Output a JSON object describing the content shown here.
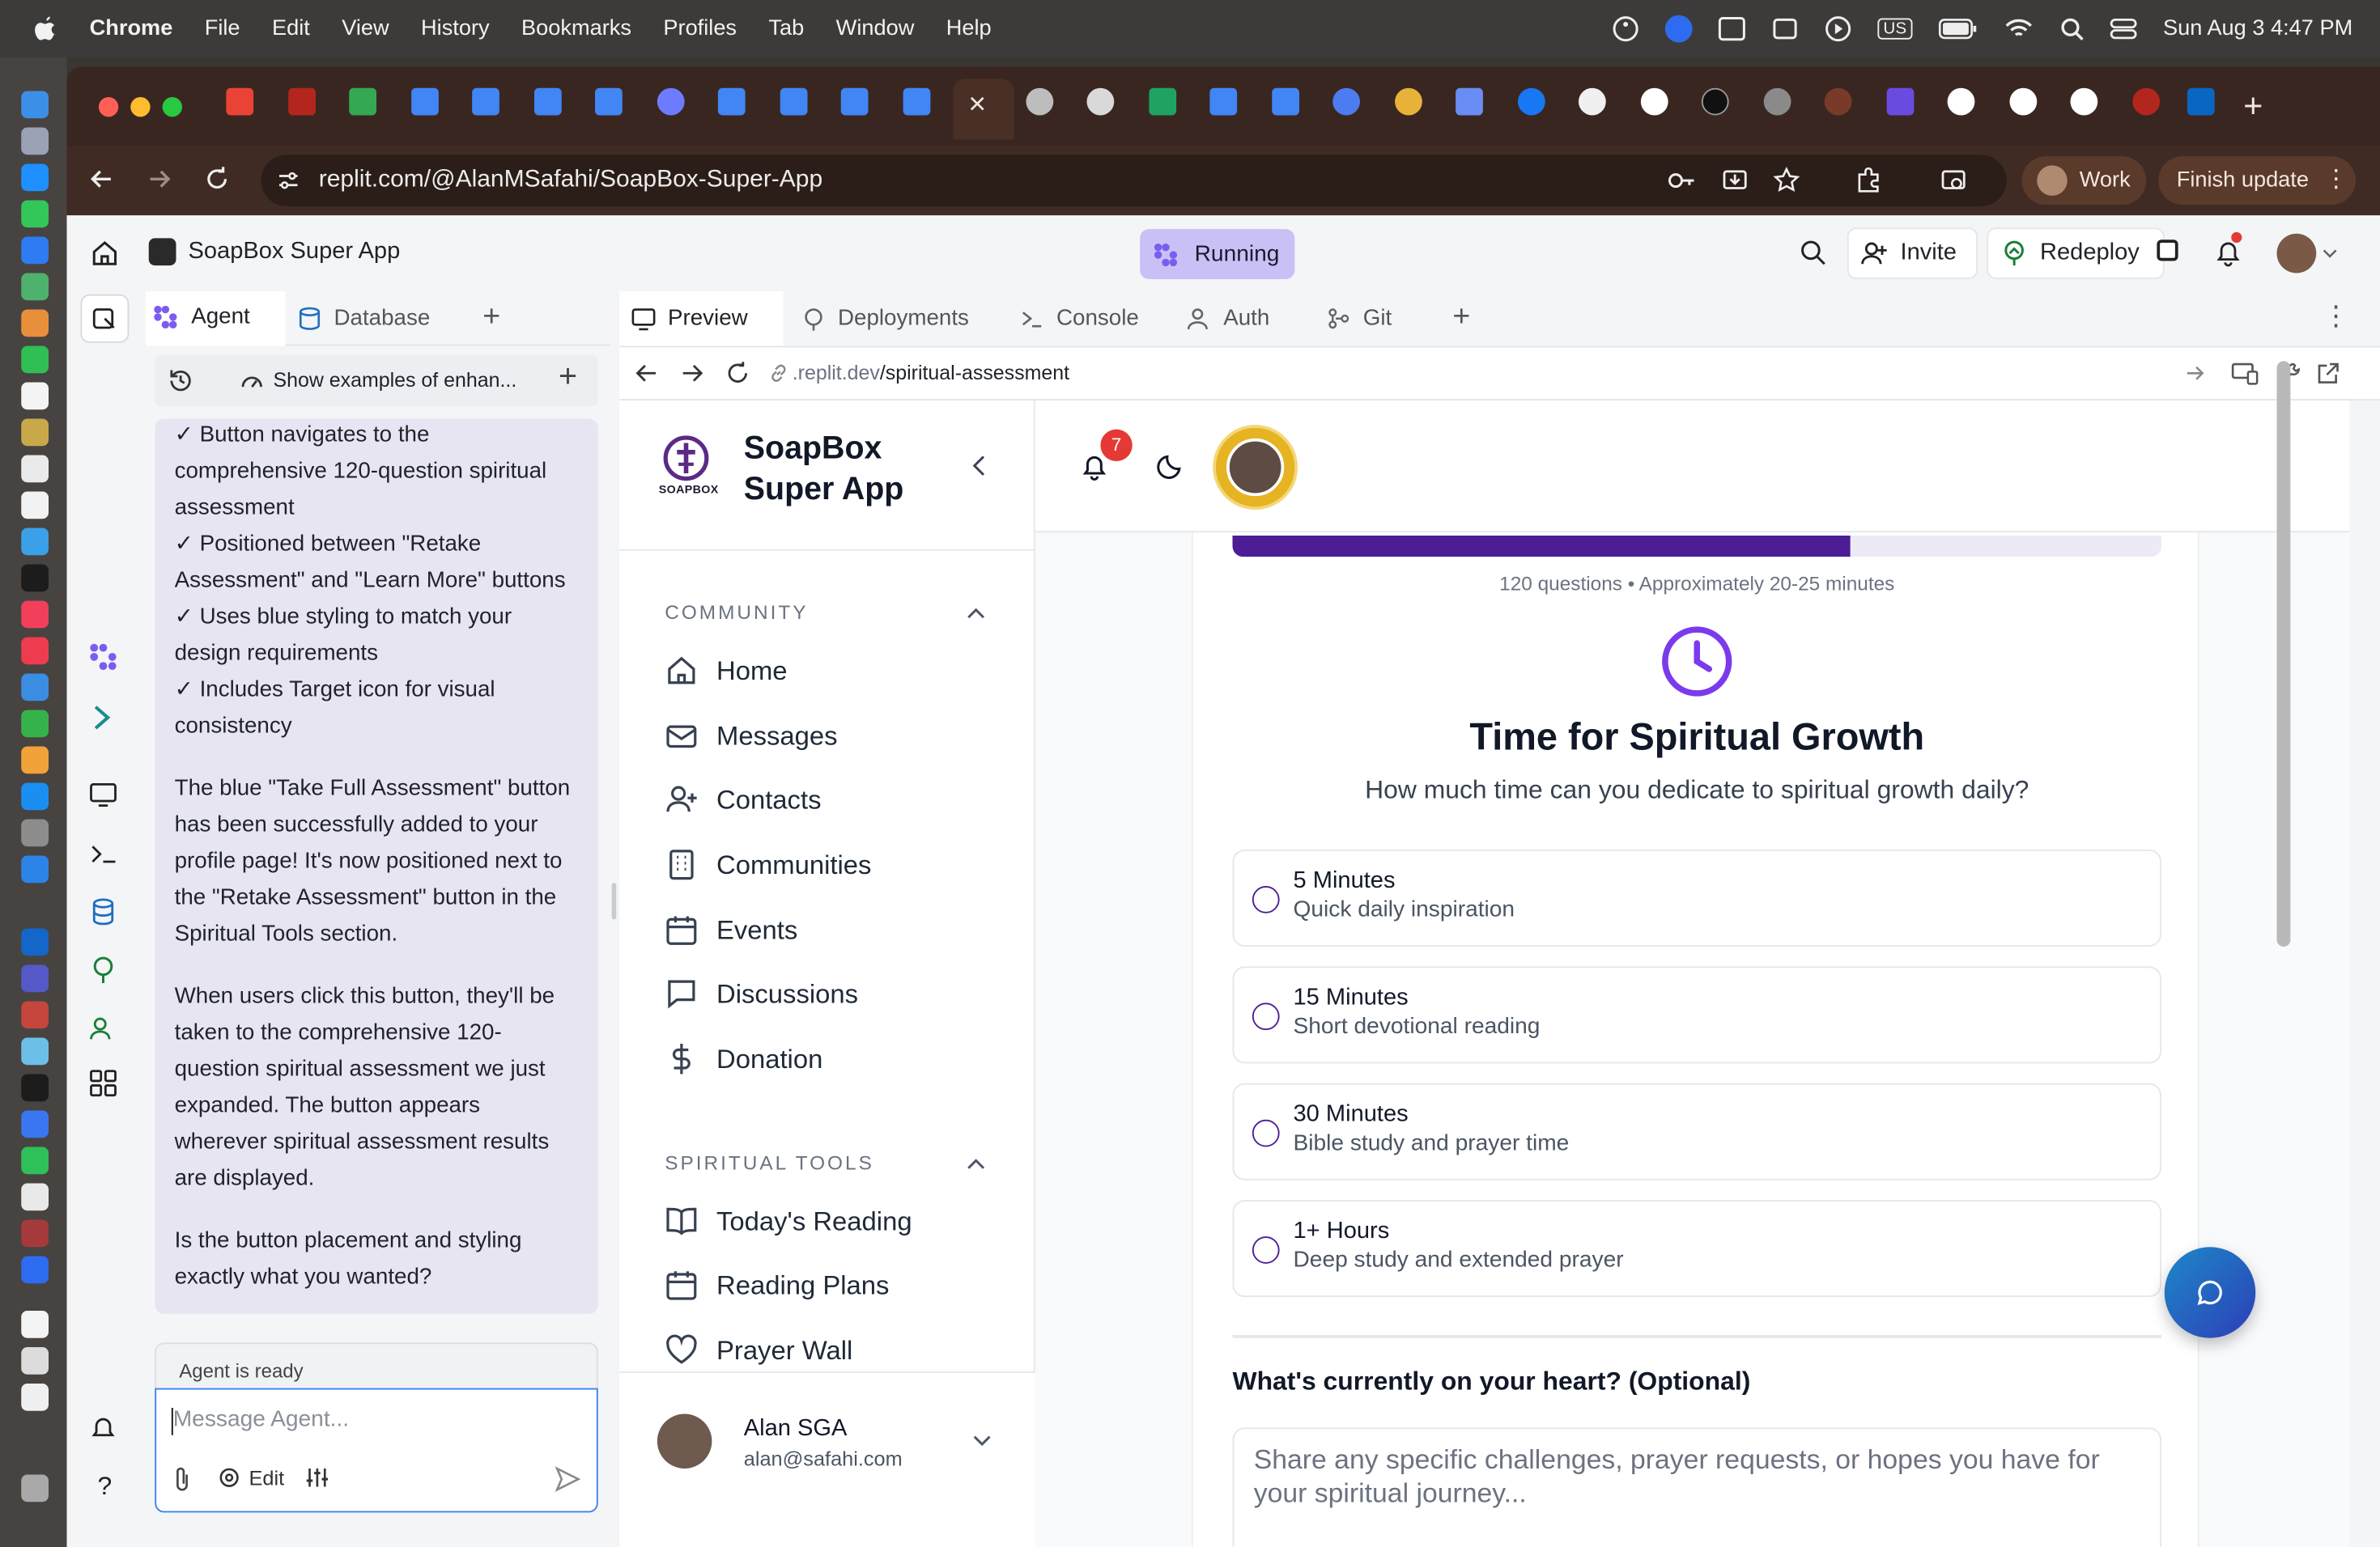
{
  "menubar": {
    "apple": "",
    "items": [
      "Chrome",
      "File",
      "Edit",
      "View",
      "History",
      "Bookmarks",
      "Profiles",
      "Tab",
      "Window",
      "Help"
    ],
    "clock": "Sun Aug 3  4:47 PM",
    "input_source": "US"
  },
  "browser": {
    "url": "replit.com/@AlanMSafahi/SoapBox-Super-App",
    "profile_label": "Work",
    "finish_update_label": "Finish update"
  },
  "replit": {
    "project_name": "SoapBox Super App",
    "status": "Running",
    "invite_label": "Invite",
    "redeploy_label": "Redeploy",
    "agent_tabs": [
      "Agent",
      "Database"
    ],
    "agent_toolbar_label": "Show examples of enhan...",
    "agent_messages": [
      "✓ Button navigates to the comprehensive 120-question spiritual assessment",
      "✓ Positioned between \"Retake Assessment\" and \"Learn More\" buttons",
      "✓ Uses blue styling to match your design requirements",
      "✓ Includes Target icon for visual consistency",
      "The blue \"Take Full Assessment\" button has been successfully added to your profile page! It's now positioned next to the \"Retake Assessment\" button in the Spiritual Tools section.",
      "When users click this button, they'll be taken to the comprehensive 120-question spiritual assessment we just expanded. The button appears wherever spiritual assessment results are displayed.",
      "Is the button placement and styling exactly what you wanted?"
    ],
    "agent_status": "Agent is ready",
    "message_placeholder": "Message Agent...",
    "edit_label": "Edit",
    "preview_tabs": [
      "Preview",
      "Deployments",
      "Console",
      "Auth",
      "Git"
    ],
    "preview_url_prefix": ".replit.dev",
    "preview_url_path": "/spiritual-assessment"
  },
  "site": {
    "brand_line1": "SoapBox",
    "brand_line2": "Super App",
    "logo_caption": "SOAPBOX",
    "notification_count": "7",
    "community_heading": "COMMUNITY",
    "community_items": [
      "Home",
      "Messages",
      "Contacts",
      "Communities",
      "Events",
      "Discussions",
      "Donation"
    ],
    "tools_heading": "SPIRITUAL TOOLS",
    "tools_items": [
      "Today's Reading",
      "Reading Plans",
      "Prayer Wall"
    ],
    "user_name": "Alan SGA",
    "user_email": "alan@safahi.com",
    "progress_fraction": 0.665,
    "progress_caption": "120 questions • Approximately 20-25 minutes",
    "question_title": "Time for Spiritual Growth",
    "question_text": "How much time can you dedicate to spiritual growth daily?",
    "options": [
      {
        "title": "5 Minutes",
        "subtitle": "Quick daily inspiration"
      },
      {
        "title": "15 Minutes",
        "subtitle": "Short devotional reading"
      },
      {
        "title": "30 Minutes",
        "subtitle": "Bible study and prayer time"
      },
      {
        "title": "1+ Hours",
        "subtitle": "Deep study and extended prayer"
      }
    ],
    "heart_label": "What's currently on your heart? (Optional)",
    "heart_placeholder": "Share any specific challenges, prayer requests, or hopes you have for your spiritual journey..."
  },
  "colors": {
    "accent_purple": "#4c1d95",
    "running_bg": "#c9c1f5",
    "badge_red": "#e53935",
    "focus_blue": "#3b82f6"
  }
}
